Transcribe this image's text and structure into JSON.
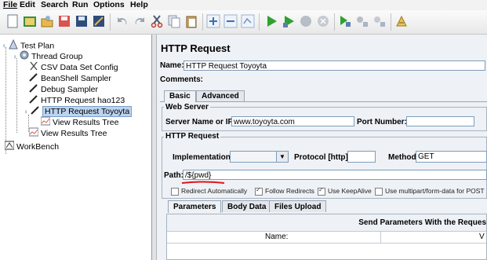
{
  "menubar": {
    "items": [
      "File",
      "Edit",
      "Search",
      "Run",
      "Options",
      "Help"
    ]
  },
  "toolbar": {
    "buttons": [
      "new-icon",
      "templates-icon",
      "open-icon",
      "save-as-icon",
      "save-icon",
      "revert-icon",
      "undo-icon",
      "redo-icon",
      "cut-icon",
      "copy-icon",
      "paste-icon",
      "expand-icon",
      "collapse-icon",
      "toggle-icon",
      "start-icon",
      "start-no-pause-icon",
      "stop-icon",
      "shutdown-icon",
      "remote-start-icon",
      "remote-stop-icon",
      "remote-shutdown-icon",
      "clear-icon"
    ]
  },
  "tree": {
    "items": [
      {
        "label": "Test Plan"
      },
      {
        "label": "Thread Group"
      },
      {
        "label": "CSV Data Set Config"
      },
      {
        "label": "BeanShell Sampler"
      },
      {
        "label": "Debug Sampler"
      },
      {
        "label": "HTTP Request  hao123"
      },
      {
        "label": "HTTP Request  Toyoyta"
      },
      {
        "label": "View Results Tree"
      },
      {
        "label": "View Results Tree"
      },
      {
        "label": "WorkBench"
      }
    ]
  },
  "panel": {
    "title": "HTTP Request",
    "name_label": "Name:",
    "name_value": "HTTP Request  Toyoyta",
    "comments_label": "Comments:",
    "tabs": [
      "Basic",
      "Advanced"
    ],
    "web_server": {
      "legend": "Web Server",
      "server_label": "Server Name or IP:",
      "server_value": "www.toyoyta.com",
      "port_label": "Port Number:",
      "port_value": ""
    },
    "http_request": {
      "legend": "HTTP Request",
      "impl_label": "Implementation:",
      "impl_value": "",
      "protocol_label": "Protocol [http]:",
      "protocol_value": "",
      "method_label": "Method:",
      "method_value": "GET",
      "path_label": "Path:",
      "path_value": "/${pwd}"
    },
    "checkboxes": [
      {
        "label": "Redirect Automatically",
        "checked": false
      },
      {
        "label": "Follow Redirects",
        "checked": true
      },
      {
        "label": "Use KeepAlive",
        "checked": true
      },
      {
        "label": "Use multipart/form-data for POST",
        "checked": false
      }
    ],
    "param_tabs": [
      "Parameters",
      "Body Data",
      "Files Upload"
    ],
    "params_header": "Send Parameters With the Reques",
    "params_col_name": "Name:",
    "params_col_value": "V"
  },
  "colors": {
    "selection": "#bcd4ef",
    "underline_annotation": "#e0141c",
    "run_green": "#2fa12f"
  }
}
